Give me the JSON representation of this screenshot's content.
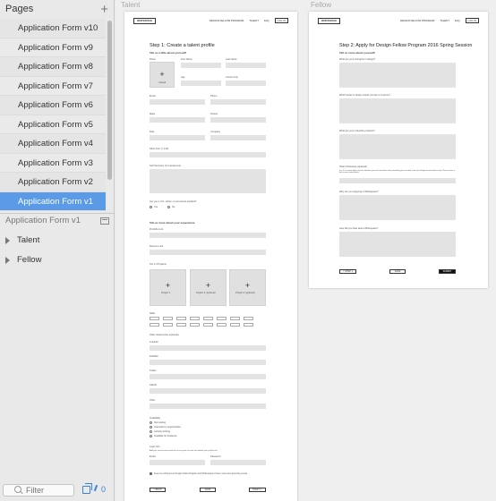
{
  "sidebar": {
    "title": "Pages",
    "add_symbol": "+",
    "pages": [
      "Application Form v10",
      "Application Form v9",
      "Application Form v8",
      "Application Form v7",
      "Application Form v6",
      "Application Form v5",
      "Application Form v4",
      "Application Form v3",
      "Application Form v2",
      "Application Form v1"
    ],
    "selected_page": "Application Form v1",
    "current_page_title": "Application Form v1",
    "layers": [
      "Talent",
      "Fellow"
    ],
    "filter_placeholder": "Filter",
    "badge_count": "0"
  },
  "colors": {
    "selection": "#5a9ae6",
    "accent": "#3b82d6"
  },
  "artboards": {
    "talent": {
      "label": "Talent",
      "nav": {
        "logo": "WHITESPACE",
        "program": "DESIGN FELLOW PROGRAM",
        "talent": "TALENT",
        "faq": "FAQ",
        "login": "LOG IN"
      },
      "heading": "Step 1: Create a talent profile",
      "subheading": "Tell us a little about yourself!",
      "photo_label": "Photo",
      "upload_label": "Upload",
      "fields": {
        "first_name": "First Name",
        "last_name": "Last Name",
        "age": "Age",
        "current_city": "Current City",
        "email": "Email",
        "phone": "Phone",
        "major": "Major",
        "school": "School",
        "role": "Role",
        "company": "Company",
        "short_intro": "Short Intro (< 140)",
        "self_summary": "Self Summary (3-4 sentences)",
        "us_question": "Are you a U.S. citizen or permanent resident?",
        "yes": "Yes",
        "no": "No",
        "experience_heading": "Tell us more about your experience.",
        "portfolio": "Portfolio Link",
        "resume": "Resume Link",
        "projects_heading": "Top 1-3 Projects",
        "project1": "Project 1",
        "project2": "Project 2 (optional)",
        "project3": "Project 3 (optional)",
        "skills": "Skills",
        "other_social": "Other Social Links (optional)",
        "linkedin": "LinkedIn",
        "dribbble": "Dribbble",
        "twitter": "Twitter",
        "github": "GitHub",
        "other": "Other",
        "availability": "Availability",
        "availability_options": [
          "Not looking",
          "Interested in opportunities",
          "Actively looking",
          "Available for freelance"
        ],
        "login_info": "Login Info",
        "login_note": "Add your email and password to access your account and update your profile later.",
        "login_email": "Email",
        "password": "Password",
        "keep_informed": "Keep me informed on Design Fellow Program and Whitespace's future news and upcoming events."
      },
      "buttons": {
        "back": "< BACK",
        "save": "SAVE",
        "next": "STEP 2 >"
      }
    },
    "fellow": {
      "label": "Fellow",
      "nav": {
        "logo": "WHITESPACE",
        "program": "DESIGN FELLOW PROGRAM",
        "talent": "TALENT",
        "faq": "FAQ",
        "login": "LOG IN"
      },
      "heading": "Step 2: Apply for Design Fellow Program 2016 Spring Session",
      "subheading": "Tell us more about yourself!",
      "questions": [
        "What are your strengths in design?",
        "Which areas in design would you like to improve?",
        "What are your 3 favorite products?",
        "Video Showcase (optional)",
        "Why are you applying to Whitespace?",
        "How did you hear about Whitespace?"
      ],
      "video_note": "In a 1-2 minute video, please introduce yourself and share why something you consider to be well designed and explain why. Please share a link to your video below.",
      "buttons": {
        "step1": "< STEP 1",
        "save": "SAVE",
        "submit": "SUBMIT"
      }
    }
  }
}
